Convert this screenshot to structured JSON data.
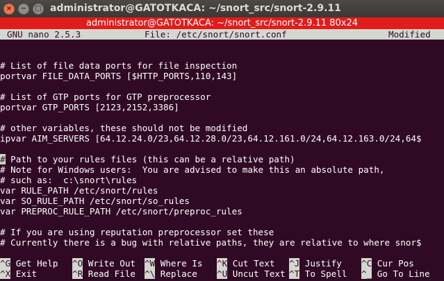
{
  "window": {
    "title": "administrator@GATOTKACA: ~/snort_src/snort-2.9.11",
    "close_glyph": "×",
    "minimize_glyph": "−",
    "maximize_glyph": "□"
  },
  "terminal_title": "administrator@GATOTKACA: ~/snort_src/snort-2.9.11 80x24",
  "nano": {
    "version": "GNU nano 2.5.3",
    "file": "File: /etc/snort/snort.conf",
    "status": "Modified"
  },
  "editor_lines": [
    "",
    "",
    "# List of file data ports for file inspection",
    "portvar FILE_DATA_PORTS [$HTTP_PORTS,110,143]",
    "",
    "# List of GTP ports for GTP preprocessor",
    "portvar GTP_PORTS [2123,2152,3386]",
    "",
    "# other variables, these should not be modified",
    "ipvar AIM_SERVERS [64.12.24.0/23,64.12.28.0/23,64.12.161.0/24,64.12.163.0/24,64$",
    "",
    " Path to your rules files (this can be a relative path)",
    "# Note for Windows users:  You are advised to make this an absolute path,",
    "# such as:  c:\\snort\\rules",
    "var RULE_PATH /etc/snort/rules",
    "var SO_RULE_PATH /etc/snort/so_rules",
    "var PREPROC_RULE_PATH /etc/snort/preproc_rules",
    "",
    "# If you are using reputation preprocessor set these",
    "# Currently there is a bug with relative paths, they are relative to where snor$"
  ],
  "cursor_char": "#",
  "shortcuts": {
    "row1": [
      {
        "key": "^G",
        "label": "Get Help"
      },
      {
        "key": "^O",
        "label": "Write Out"
      },
      {
        "key": "^W",
        "label": "Where Is"
      },
      {
        "key": "^K",
        "label": "Cut Text"
      },
      {
        "key": "^J",
        "label": "Justify"
      },
      {
        "key": "^C",
        "label": "Cur Pos"
      }
    ],
    "row2": [
      {
        "key": "^X",
        "label": "Exit"
      },
      {
        "key": "^R",
        "label": "Read File"
      },
      {
        "key": "^\\",
        "label": "Replace"
      },
      {
        "key": "^U",
        "label": "Uncut Text"
      },
      {
        "key": "^T",
        "label": "To Spell"
      },
      {
        "key": "^_",
        "label": "Go To Line"
      }
    ]
  }
}
